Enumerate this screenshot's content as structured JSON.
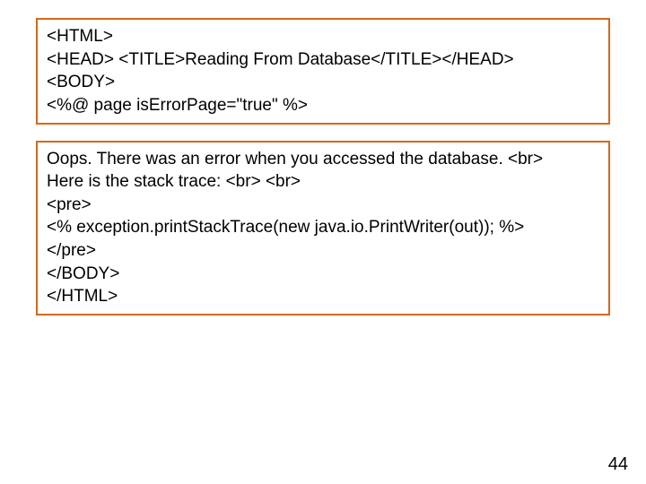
{
  "box1": {
    "lines": [
      "<HTML>",
      "<HEAD> <TITLE>Reading From Database</TITLE></HEAD>",
      "<BODY>",
      "<%@ page isErrorPage=\"true\" %>"
    ]
  },
  "box2": {
    "lines": [
      "Oops. There was an error when you accessed the database. <br>",
      "Here is the stack trace: <br> <br>",
      "<pre>",
      "<% exception.printStackTrace(new java.io.PrintWriter(out)); %>",
      "</pre>",
      "</BODY>",
      "</HTML>"
    ]
  },
  "page_number": "44"
}
